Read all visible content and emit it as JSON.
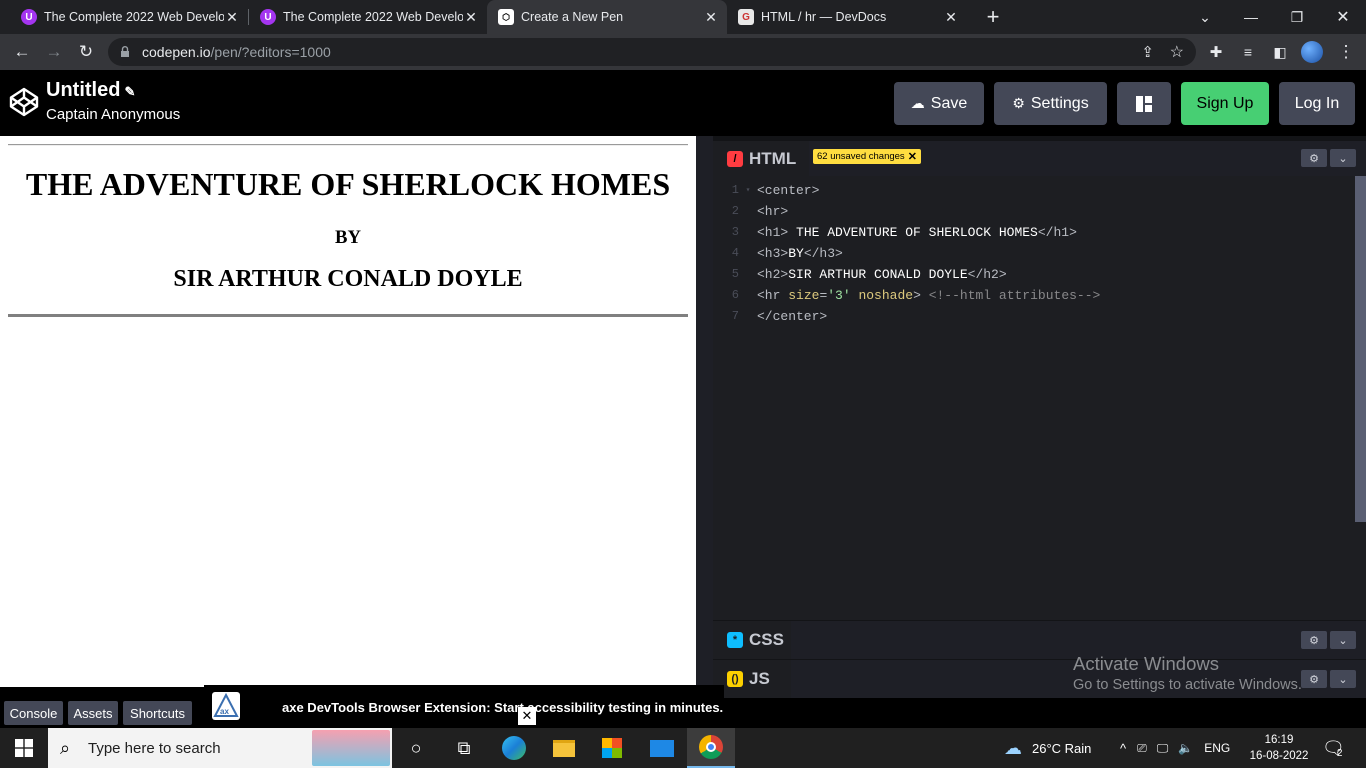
{
  "browser": {
    "tabs": [
      {
        "title": "The Complete 2022 Web Develop",
        "close": "✕"
      },
      {
        "title": "The Complete 2022 Web Develop",
        "close": "✕"
      },
      {
        "title": "Create a New Pen",
        "close": "✕"
      },
      {
        "title": "HTML / hr — DevDocs",
        "close": "✕"
      }
    ],
    "new_tab": "+",
    "url_host": "codepen.io",
    "url_path": "/pen/?editors=1000"
  },
  "header": {
    "title": "Untitled",
    "user": "Captain Anonymous",
    "save": "Save",
    "settings": "Settings",
    "signup": "Sign Up",
    "login": "Log In"
  },
  "preview": {
    "h1": "THE ADVENTURE OF SHERLOCK HOMES",
    "h3": "BY",
    "h2": "SIR ARTHUR CONALD DOYLE"
  },
  "editor": {
    "html_label": "HTML",
    "unsaved": "62 unsaved changes",
    "css_label": "CSS",
    "js_label": "JS",
    "line_numbers": [
      "1",
      "2",
      "3",
      "4",
      "5",
      "6",
      "7"
    ],
    "code": {
      "l1": "<center>",
      "l2": "<hr>",
      "l3_open": "<h1>",
      "l3_text": " THE ADVENTURE OF SHERLOCK HOMES",
      "l3_close": "</h1>",
      "l4_open": "<h3>",
      "l4_text": "BY",
      "l4_close": "</h3>",
      "l5_open": "<h2>",
      "l5_text": "SIR ARTHUR CONALD DOYLE",
      "l5_close": "</h2>",
      "l6_tag": "<hr ",
      "l6_attr": "size",
      "l6_eq": "=",
      "l6_val": "'3'",
      "l6_attr2": " noshade",
      "l6_end": ">",
      "l6_comment": " <!--html attributes-->",
      "l7": "</center>"
    }
  },
  "footer": {
    "console": "Console",
    "assets": "Assets",
    "shortcuts": "Shortcuts"
  },
  "axe_banner": {
    "text": "axe DevTools Browser Extension: Start accessibility testing in minutes.",
    "close": "✕"
  },
  "watermark": {
    "line1": "Activate Windows",
    "line2": "Go to Settings to activate Windows."
  },
  "taskbar": {
    "search_placeholder": "Type here to search",
    "weather": "26°C  Rain",
    "lang": "ENG",
    "time": "16:19",
    "date": "16-08-2022",
    "notifications": "2"
  },
  "colors": {
    "accent_green": "#47cf73",
    "button_gray": "#444857",
    "unsaved_yellow": "#ffdd40",
    "html_icon": "#ff3c41",
    "css_icon": "#0ebeff",
    "js_icon": "#fcd000"
  }
}
